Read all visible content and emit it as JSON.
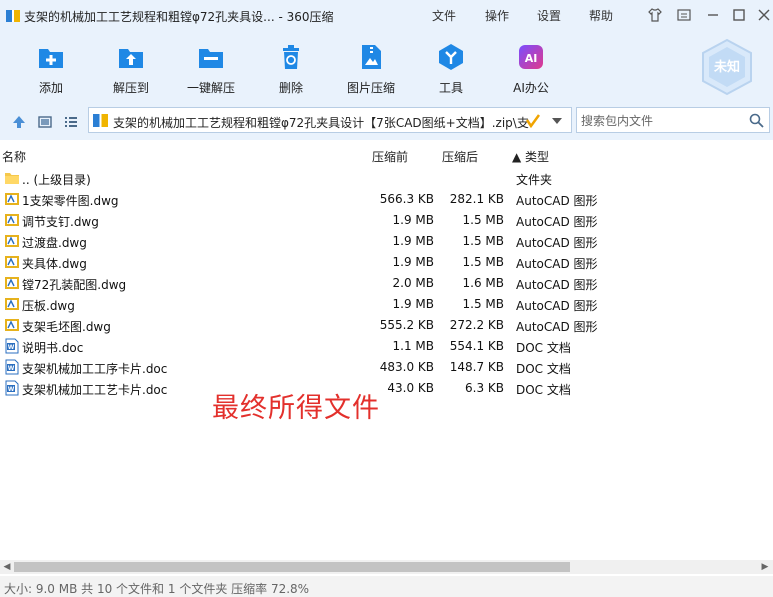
{
  "window": {
    "title": "支架的机械加工工艺规程和粗镗φ72孔夹具设... - 360压缩",
    "menu": [
      "文件",
      "操作",
      "设置",
      "帮助"
    ]
  },
  "toolbar": {
    "buttons": [
      {
        "label": "添加",
        "icon": "add-archive-icon"
      },
      {
        "label": "解压到",
        "icon": "extract-to-icon"
      },
      {
        "label": "一键解压",
        "icon": "one-click-extract-icon"
      },
      {
        "label": "删除",
        "icon": "trash-icon"
      },
      {
        "label": "图片压缩",
        "icon": "image-compress-icon"
      },
      {
        "label": "工具",
        "icon": "tools-icon"
      },
      {
        "label": "AI办公",
        "icon": "ai-office-icon"
      }
    ],
    "badge": "未知"
  },
  "address": {
    "path": "支架的机械加工工艺规程和粗镗φ72孔夹具设计【7张CAD图纸+文档】.zip\\支"
  },
  "search": {
    "placeholder": "搜索包内文件"
  },
  "columns": {
    "name": "名称",
    "original": "压缩前",
    "compressed": "压缩后",
    "type": "▲ 类型"
  },
  "files": [
    {
      "name": ".. (上级目录)",
      "original": "",
      "compressed": "",
      "type": "文件夹",
      "icon": "folder"
    },
    {
      "name": "1支架零件图.dwg",
      "original": "566.3 KB",
      "compressed": "282.1 KB",
      "type": "AutoCAD 图形",
      "icon": "dwg"
    },
    {
      "name": "调节支钉.dwg",
      "original": "1.9 MB",
      "compressed": "1.5 MB",
      "type": "AutoCAD 图形",
      "icon": "dwg"
    },
    {
      "name": "过渡盘.dwg",
      "original": "1.9 MB",
      "compressed": "1.5 MB",
      "type": "AutoCAD 图形",
      "icon": "dwg"
    },
    {
      "name": "夹具体.dwg",
      "original": "1.9 MB",
      "compressed": "1.5 MB",
      "type": "AutoCAD 图形",
      "icon": "dwg"
    },
    {
      "name": "镗72孔装配图.dwg",
      "original": "2.0 MB",
      "compressed": "1.6 MB",
      "type": "AutoCAD 图形",
      "icon": "dwg"
    },
    {
      "name": "压板.dwg",
      "original": "1.9 MB",
      "compressed": "1.5 MB",
      "type": "AutoCAD 图形",
      "icon": "dwg"
    },
    {
      "name": "支架毛坯图.dwg",
      "original": "555.2 KB",
      "compressed": "272.2 KB",
      "type": "AutoCAD 图形",
      "icon": "dwg"
    },
    {
      "name": "说明书.doc",
      "original": "1.1 MB",
      "compressed": "554.1 KB",
      "type": "DOC 文档",
      "icon": "doc"
    },
    {
      "name": "支架机械加工工序卡片.doc",
      "original": "483.0 KB",
      "compressed": "148.7 KB",
      "type": "DOC 文档",
      "icon": "doc"
    },
    {
      "name": "支架机械加工工艺卡片.doc",
      "original": "43.0 KB",
      "compressed": "6.3 KB",
      "type": "DOC 文档",
      "icon": "doc"
    }
  ],
  "overlay_text": "最终所得文件",
  "status": "大小: 9.0 MB 共 10 个文件和 1 个文件夹 压缩率 72.8%",
  "colors": {
    "toolbar_bg": "#e9f2fc",
    "accent": "#1f88e5",
    "overlay": "#e3302c"
  }
}
